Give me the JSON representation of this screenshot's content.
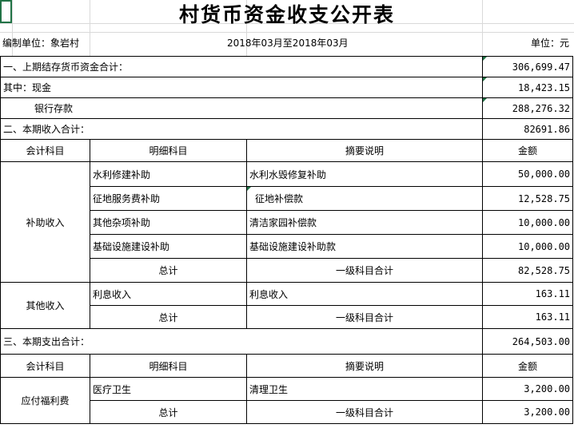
{
  "title": "村货币资金收支公开表",
  "header": {
    "unit_label": "编制单位：象岩村",
    "period": "2018年03月至2018年03月",
    "currency": "单位：元"
  },
  "summary": {
    "prev_balance_label": "一、上期结存货币资金合计：",
    "prev_balance_value": "306,699.47",
    "cash_label": "其中：现金",
    "cash_value": "18,423.15",
    "bank_label": "银行存款",
    "bank_value": "288,276.32",
    "income_total_label": "二、本期收入合计：",
    "income_total_value": "82691.86",
    "expense_total_label": "三、本期支出合计：",
    "expense_total_value": "264,503.00"
  },
  "columns": {
    "account": "会计科目",
    "detail": "明细科目",
    "description": "摘要说明",
    "amount": "金额"
  },
  "income": {
    "subsidy": {
      "account": "补助收入",
      "rows": [
        {
          "detail": "水利修建补助",
          "description": "水利水毁修复补助",
          "amount": "50,000.00"
        },
        {
          "detail": "征地服务费补助",
          "description": "征地补偿款",
          "amount": "12,528.75"
        },
        {
          "detail": "其他杂项补助",
          "description": "清洁家园补偿款",
          "amount": "10,000.00"
        },
        {
          "detail": "基础设施建设补助",
          "description": "基础设施建设补助款",
          "amount": "10,000.00"
        }
      ],
      "total_label": "总计",
      "total_desc": "一级科目合计",
      "total_amount": "82,528.75"
    },
    "other": {
      "account": "其他收入",
      "rows": [
        {
          "detail": "利息收入",
          "description": "利息收入",
          "amount": "163.11"
        }
      ],
      "total_label": "总计",
      "total_desc": "一级科目合计",
      "total_amount": "163.11"
    }
  },
  "expense": {
    "welfare": {
      "account": "应付福利费",
      "rows": [
        {
          "detail": "医疗卫生",
          "description": "清理卫生",
          "amount": "3,200.00"
        }
      ],
      "total_label": "总计",
      "total_desc": "一级科目合计",
      "total_amount": "3,200.00"
    }
  },
  "colors": {
    "selection": "#217346",
    "grid": "#d9d9d9",
    "border": "#000000"
  }
}
